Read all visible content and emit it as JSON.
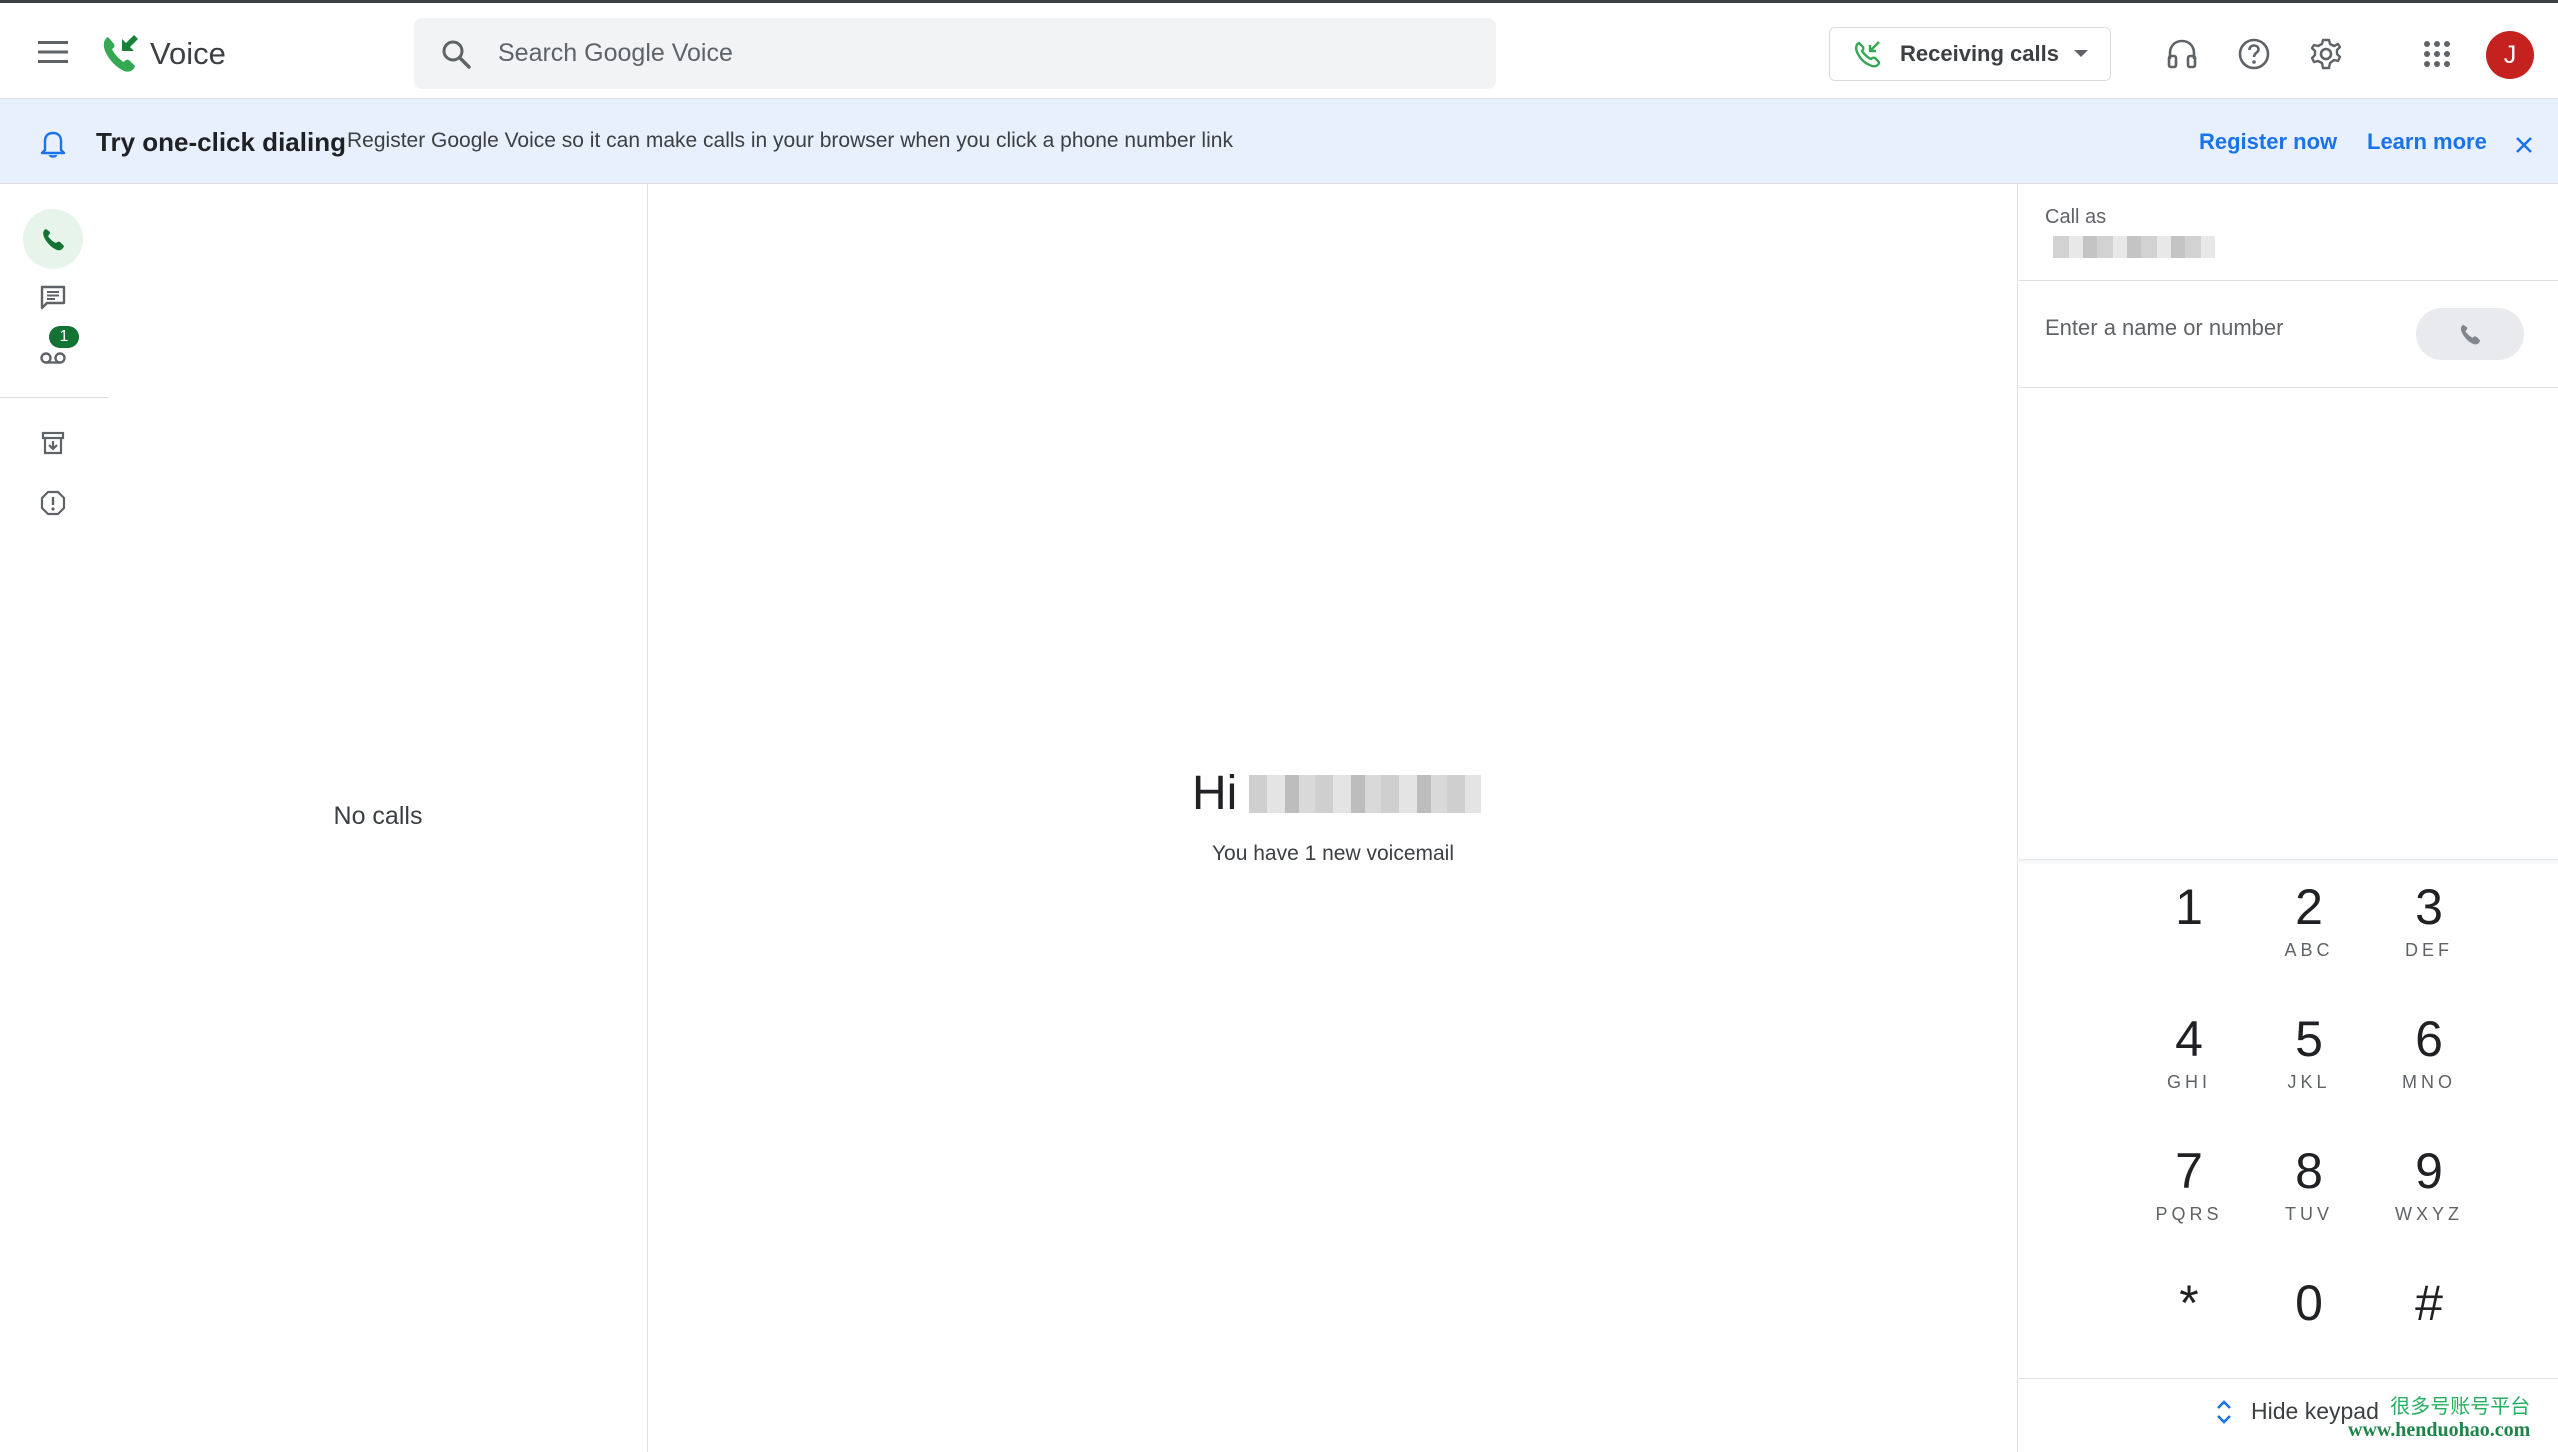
{
  "app": {
    "name": "Voice",
    "avatar_letter": "J",
    "brand_color": "#34a853",
    "avatar_color": "#c5221f"
  },
  "search": {
    "placeholder": "Search Google Voice"
  },
  "status": {
    "label": "Receiving calls"
  },
  "banner": {
    "title": "Try one-click dialing",
    "text": "Register Google Voice so it can make calls in your browser when you click a phone number link",
    "register_label": "Register now",
    "learn_label": "Learn more"
  },
  "nav": {
    "items": [
      {
        "name": "calls",
        "icon": "phone-icon",
        "active": true
      },
      {
        "name": "messages",
        "icon": "message-icon"
      },
      {
        "name": "voicemail",
        "icon": "voicemail-icon",
        "badge": "1"
      },
      {
        "name": "archive",
        "icon": "archive-icon"
      },
      {
        "name": "spam",
        "icon": "spam-icon"
      }
    ]
  },
  "calls": {
    "empty_text": "No calls"
  },
  "main": {
    "greeting": "Hi",
    "voicemail_text": "You have 1 new voicemail"
  },
  "dialer": {
    "call_as_label": "Call as",
    "input_placeholder": "Enter a name or number",
    "keys": [
      {
        "digit": "1",
        "letters": ""
      },
      {
        "digit": "2",
        "letters": "ABC"
      },
      {
        "digit": "3",
        "letters": "DEF"
      },
      {
        "digit": "4",
        "letters": "GHI"
      },
      {
        "digit": "5",
        "letters": "JKL"
      },
      {
        "digit": "6",
        "letters": "MNO"
      },
      {
        "digit": "7",
        "letters": "PQRS"
      },
      {
        "digit": "8",
        "letters": "TUV"
      },
      {
        "digit": "9",
        "letters": "WXYZ"
      },
      {
        "digit": "*",
        "letters": ""
      },
      {
        "digit": "0",
        "letters": ""
      },
      {
        "digit": "#",
        "letters": ""
      }
    ],
    "hide_keypad_label": "Hide keypad"
  },
  "watermark": {
    "line1": "很多号账号平台",
    "line2": "www.henduohao.com"
  }
}
